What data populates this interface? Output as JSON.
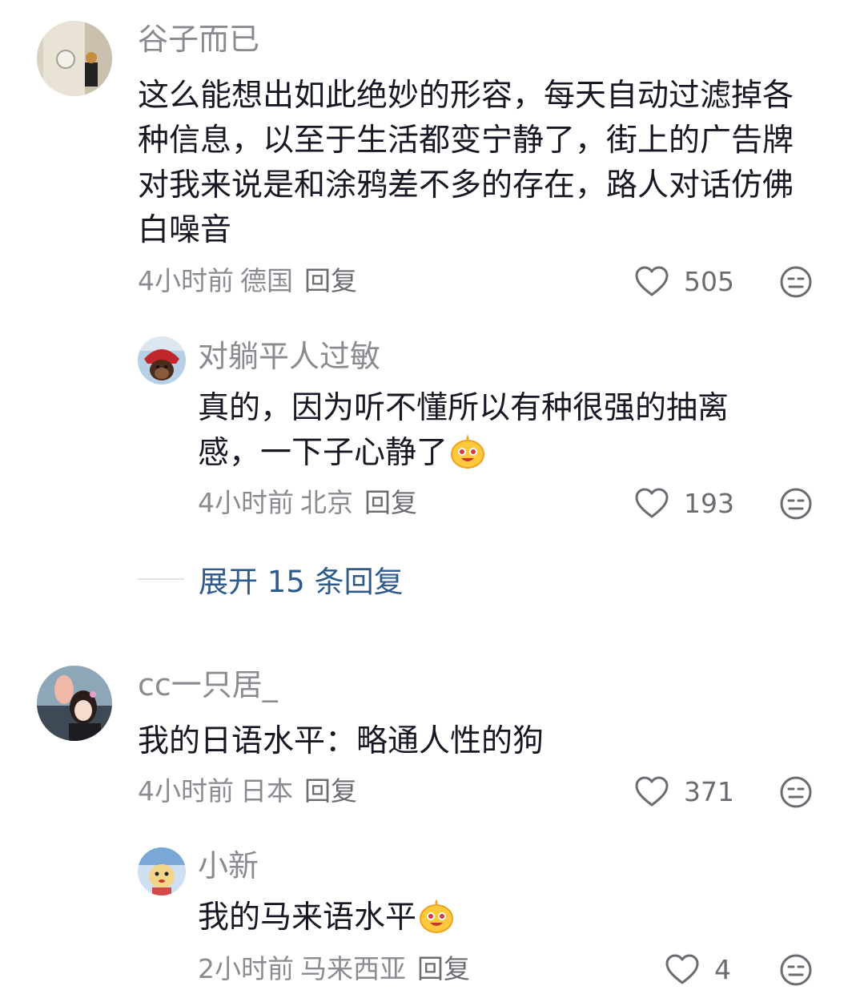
{
  "comments": [
    {
      "username": "谷子而已",
      "content": "这么能想出如此绝妙的形容，每天自动过滤掉各种信息，以至于生活都变宁静了，街上的广告牌对我来说是和涂鸦差不多的存在，路人对话仿佛白噪音",
      "time": "4小时前",
      "location": "德国",
      "reply_label": "回复",
      "likes": "505",
      "avatar_icon": "photo-avatar-room",
      "replies": [
        {
          "username": "对躺平人过敏",
          "content": "真的，因为听不懂所以有种很强的抽离感，一下子心静了",
          "emoji": "smiley-emoji",
          "time": "4小时前",
          "location": "北京",
          "reply_label": "回复",
          "likes": "193",
          "avatar_icon": "monkey-avatar"
        }
      ],
      "expand_label": "展开 15 条回复"
    },
    {
      "username": "cc一只居_",
      "content": "我的日语水平：略通人性的狗",
      "time": "4小时前",
      "location": "日本",
      "reply_label": "回复",
      "likes": "371",
      "avatar_icon": "photo-avatar-girl",
      "replies": [
        {
          "username": "小新",
          "content": "我的马来语水平",
          "emoji": "smiley-emoji",
          "time": "2小时前",
          "location": "马来西亚",
          "reply_label": "回复",
          "likes": "4",
          "avatar_icon": "cartoon-avatar"
        }
      ]
    }
  ],
  "colors": {
    "text": "#161823",
    "secondary": "#8a8b91",
    "expand_link": "#2e5a8c",
    "background": "#ffffff"
  }
}
